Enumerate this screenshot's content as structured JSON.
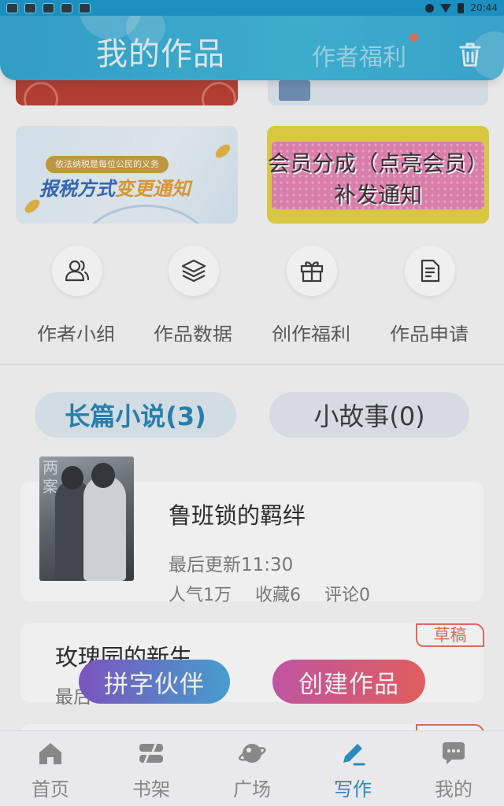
{
  "status_bar": {
    "time": "20:44"
  },
  "header": {
    "title": "我的作品",
    "tab_label": "作者福利"
  },
  "banners": {
    "tax": {
      "small_text": "依法纳税是每位公民的义务",
      "title_part1": "报税方式",
      "title_part2": "变更通知"
    },
    "member": {
      "text": "会员分成（点亮会员）补发通知"
    }
  },
  "quick_actions": [
    {
      "label": "作者小组",
      "icon": "people-icon"
    },
    {
      "label": "作品数据",
      "icon": "layers-icon"
    },
    {
      "label": "创作福利",
      "icon": "gift-icon"
    },
    {
      "label": "作品申请",
      "icon": "document-icon"
    }
  ],
  "category_tabs": {
    "long": "长篇小说(3)",
    "short": "小故事(0)"
  },
  "cover": {
    "text": "两案"
  },
  "works": [
    {
      "title": "鲁班锁的羁绊",
      "update": "最后更新11:30",
      "popularity": "人气1万",
      "favorites": "收藏6",
      "comments": "评论0"
    }
  ],
  "drafts": [
    {
      "title": "玫瑰园的新生",
      "subtitle": "最后",
      "badge": "草稿"
    }
  ],
  "buttons": {
    "partner": "拼字伙伴",
    "create": "创建作品"
  },
  "nav": [
    {
      "label": "首页",
      "icon": "home-icon"
    },
    {
      "label": "书架",
      "icon": "bookshelf-icon"
    },
    {
      "label": "广场",
      "icon": "planet-icon"
    },
    {
      "label": "写作",
      "icon": "pen-icon",
      "active": true
    },
    {
      "label": "我的",
      "icon": "chat-icon"
    }
  ],
  "colors": {
    "accent": "#1e8fc6",
    "header": "#2aa2cf",
    "draft": "#e4695a"
  }
}
